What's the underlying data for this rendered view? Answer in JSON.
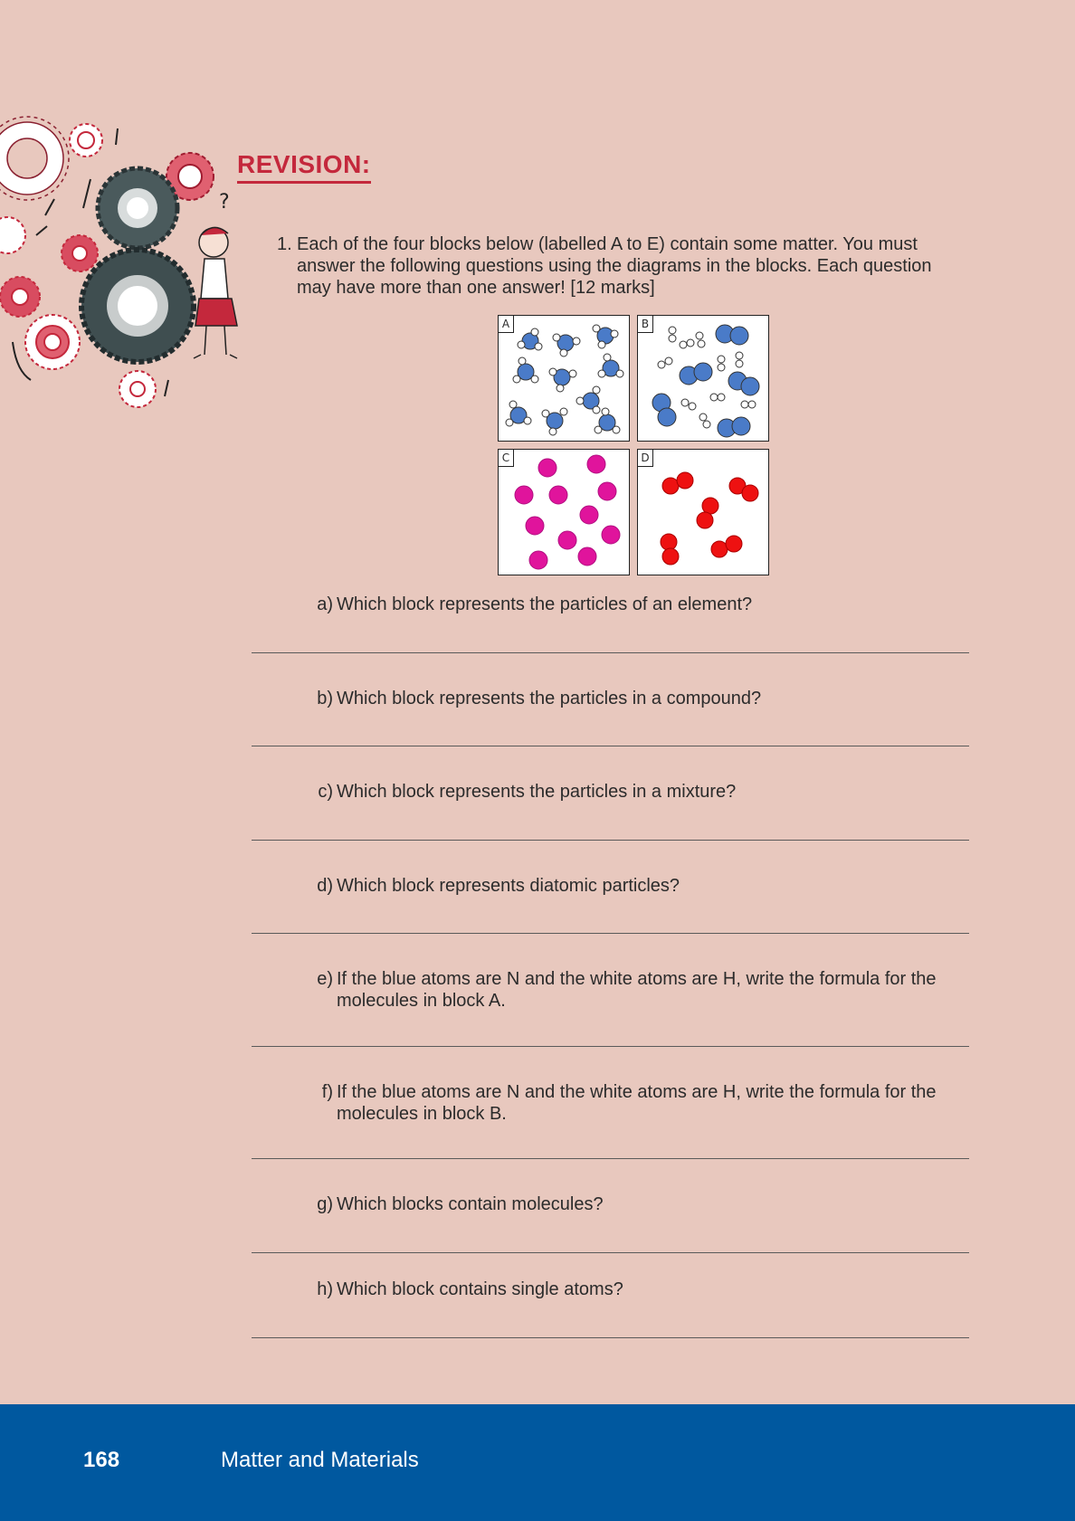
{
  "heading": "REVISION:",
  "question": {
    "number": "1.",
    "text": "Each of the four blocks below (labelled A to E) contain some matter. You must answer the following questions using the diagrams in the blocks. Each question may have more than one answer! [12 marks]"
  },
  "blocks": [
    "A",
    "B",
    "C",
    "D"
  ],
  "sub_questions": [
    {
      "label": "a)",
      "text": "Which block represents the particles of an element?"
    },
    {
      "label": "b)",
      "text": "Which block represents the particles in a compound?"
    },
    {
      "label": "c)",
      "text": "Which block represents the particles in a mixture?"
    },
    {
      "label": "d)",
      "text": "Which block represents diatomic particles?"
    },
    {
      "label": "e)",
      "text": "If the blue atoms are N and the white atoms are H, write the formula for the molecules in block A."
    },
    {
      "label": "f)",
      "text": "If the blue atoms are N and the white atoms are H, write the formula for the molecules in block B."
    },
    {
      "label": "g)",
      "text": "Which blocks contain molecules?"
    },
    {
      "label": "h)",
      "text": "Which block contains single atoms?"
    }
  ],
  "footer": {
    "page_number": "168",
    "title": "Matter and Materials"
  },
  "colors": {
    "heading": "#c4283c",
    "footer": "#00589f",
    "nitrogen": "#4a7bc8",
    "pink": "#e0149c",
    "red": "#ee1111"
  }
}
